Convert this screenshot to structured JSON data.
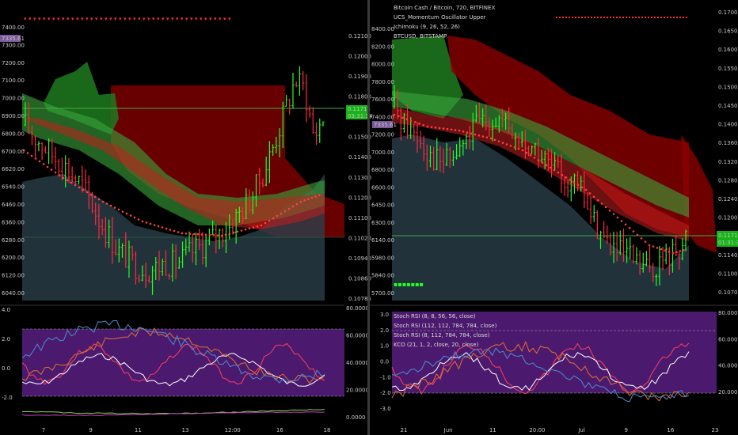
{
  "colors": {
    "background": "#000000",
    "cloud_green": "#1f8a1f",
    "cloud_red": "#8b0000",
    "candle_up": "#22ff22",
    "candle_down": "#ff2a3c",
    "osc_panel": "#4b1a6e",
    "price_line": "#3fae3f",
    "current_tag_green": "#17b317",
    "current_tag_violet": "#7a5a9a"
  },
  "left": {
    "price_axis": [
      "7400.00",
      "7300.00",
      "7200.00",
      "7100.00",
      "7000.00",
      "6900.00",
      "6800.00",
      "6700.00",
      "6620.00",
      "6540.00",
      "6460.00",
      "6360.00",
      "6280.00",
      "6200.00",
      "6120.00",
      "6040.00"
    ],
    "ratio_axis": [
      "0.12100",
      "0.12000",
      "0.11900",
      "0.11800",
      "0.11600",
      "0.11500",
      "0.11400",
      "0.11300",
      "0.11200",
      "0.11100",
      "0.11020",
      "0.10940",
      "0.10860",
      "0.10785"
    ],
    "price_tag": "7335.61",
    "ratio_tag": "0.11715",
    "time_tag": "03:31:34",
    "osc_axis": [
      "4.0",
      "2.0",
      "0.0",
      "-2.0"
    ],
    "osc_right_axis": [
      "80.0000",
      "60.0000",
      "40.0000",
      "20.0000",
      "0.0000"
    ],
    "x_axis": [
      "7",
      "9",
      "11",
      "13",
      "12:00",
      "16",
      "18"
    ]
  },
  "right": {
    "legend": [
      "Bitcoin Cash / Bitcoin, 720, BITFINEX",
      "UCS_Momentum Oscillator Upper",
      "Ichimoku (9, 26, 52, 26)",
      "BTCUSD, BITSTAMP"
    ],
    "price_axis": [
      "8400.00",
      "8200.00",
      "8000.00",
      "7800.00",
      "7600.00",
      "7400.00",
      "7200.00",
      "7000.00",
      "6800.00",
      "6600.00",
      "6450.00",
      "6300.00",
      "6140.00",
      "5980.00",
      "5840.00",
      "5700.00"
    ],
    "ratio_axis": [
      "0.17000",
      "0.16500",
      "0.16000",
      "0.15500",
      "0.15000",
      "0.14500",
      "0.14000",
      "0.13600",
      "0.13200",
      "0.12800",
      "0.12400",
      "0.12000",
      "0.11719",
      "0.11400",
      "0.11000",
      "0.10700"
    ],
    "price_tag": "7335.61",
    "ratio_tag": "0.11719",
    "time_tag": "01:31:33",
    "osc_legend": [
      "Stoch RSI (8, 8, 56, 56, close)",
      "Stoch RSI (112, 112, 784, 784, close)",
      "Stoch RSI (8, 112, 784, 784, close)",
      "KCO (21, 1, 2, close, 20, close)"
    ],
    "osc_axis": [
      "3.0",
      "2.0",
      "1.0",
      "0.0",
      "-1.0",
      "-2.0",
      "-3.0"
    ],
    "osc_right_axis": [
      "80.0000",
      "60.0000",
      "40.0000",
      "20.0000"
    ],
    "x_axis": [
      "21",
      "Jun",
      "11",
      "20:00",
      "Jul",
      "9",
      "16",
      "23"
    ]
  },
  "chart_data": [
    {
      "type": "candlestick",
      "title": "",
      "ylim": [
        6040,
        7450
      ],
      "close_path": [
        6960,
        6900,
        6850,
        6800,
        6760,
        6700,
        6650,
        6560,
        6460,
        6380,
        6300,
        6260,
        6220,
        6200,
        6210,
        6240,
        6230,
        6260,
        6300,
        6330,
        6360,
        6400,
        6430,
        6500,
        6560,
        6650,
        6760,
        6900,
        7050,
        7200,
        7150,
        6900,
        7000
      ],
      "price_level": 7000
    },
    {
      "type": "candlestick",
      "title": "Bitcoin Cash / Bitcoin, 720, BITFINEX",
      "ylim": [
        5700,
        8500
      ],
      "close_path": [
        7700,
        7500,
        7400,
        7200,
        7100,
        7150,
        7300,
        7500,
        7600,
        7550,
        7400,
        7300,
        7250,
        7100,
        7000,
        6900,
        6800,
        6500,
        6300,
        6150,
        6100,
        6000,
        5950,
        6050,
        6150,
        6300
      ],
      "price_level": 6200
    }
  ]
}
